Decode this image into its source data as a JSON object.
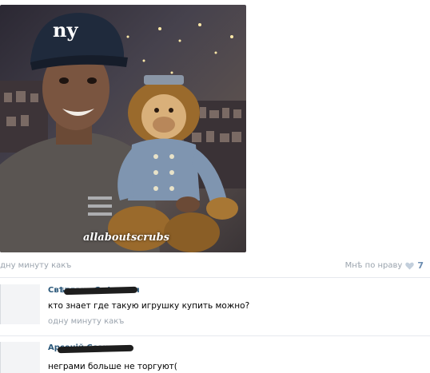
{
  "post": {
    "watermark": "allaboutscrubs",
    "time": "одну минуту какъ",
    "like_label": "Мнѣ по нраву",
    "like_count": "7"
  },
  "comments": [
    {
      "author": "Свѣтлана Смѣльная",
      "text": "кто знает где такую игрушку купить можно?",
      "time": "одну минуту какъ"
    },
    {
      "author": "Арсеній Ссенько",
      "text": "неграми больше не торгуют("
    }
  ],
  "colors": {
    "link": "#2b587a",
    "meta": "#9aa3ad",
    "like_count": "#6b8cb0"
  },
  "icons": [
    "heart-icon"
  ]
}
